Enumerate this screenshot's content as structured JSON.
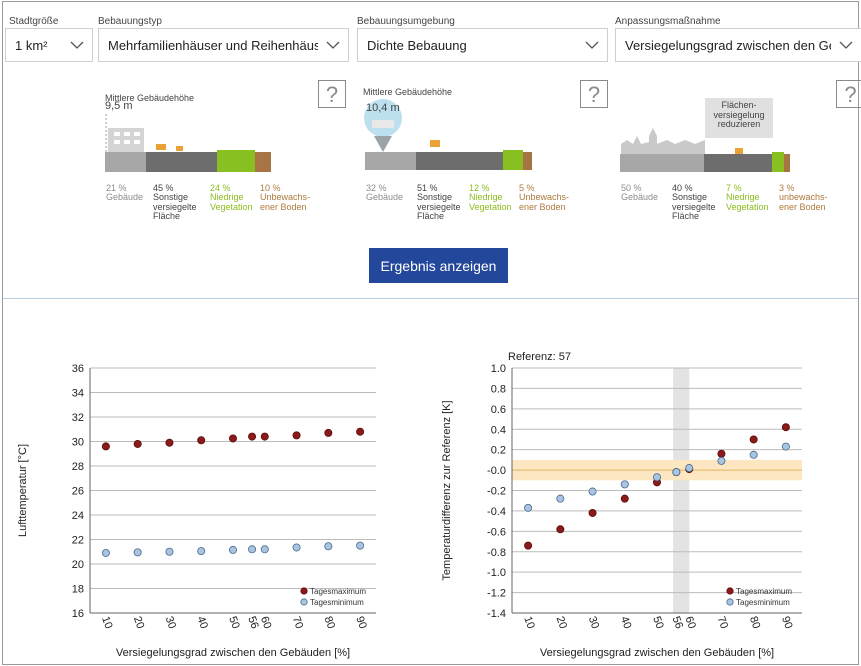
{
  "selectors": [
    {
      "label": "Stadtgröße",
      "value": "1 km²"
    },
    {
      "label": "Bebauungstyp",
      "value": "Mehrfamilienhäuser und Reihenhäuser"
    },
    {
      "label": "Bebauungsumgebung",
      "value": "Dichte Bebauung"
    },
    {
      "label": "Anpassungsmaßnahme",
      "value": "Versiegelungsgrad zwischen den Gebäuden"
    }
  ],
  "help_glyph": "?",
  "panels": [
    {
      "height_label": "Mittlere Gebäudehöhe",
      "height_value": "9,5 m",
      "shares": [
        {
          "pct": "21 %",
          "text": "Gebäude"
        },
        {
          "pct": "45 %",
          "text": "Sonstige versiegelte Fläche"
        },
        {
          "pct": "24 %",
          "text": "Niedrige Vegetation"
        },
        {
          "pct": "10 %",
          "text": "Unbewachs-ener Boden"
        }
      ]
    },
    {
      "height_label": "Mittlere Gebäudehöhe",
      "height_value": "10,4 m",
      "shares": [
        {
          "pct": "32 %",
          "text": "Gebäude"
        },
        {
          "pct": "51 %",
          "text": "Sonstige versiegelte Fläche"
        },
        {
          "pct": "12 %",
          "text": "Niedrige Vegetation"
        },
        {
          "pct": "5 %",
          "text": "Unbewachs-ener Boden"
        }
      ]
    },
    {
      "callout": "Flächen-versiegelung reduzieren",
      "shares": [
        {
          "pct": "50 %",
          "text": "Gebäude"
        },
        {
          "pct": "40 %",
          "text": "Sonstige versiegelte Fläche"
        },
        {
          "pct": "7 %",
          "text": "Niedrige Vegetation"
        },
        {
          "pct": "3 %",
          "text": "unbewachs-ener Boden"
        }
      ]
    }
  ],
  "result_button": "Ergebnis anzeigen",
  "colors": {
    "accent": "#23479a",
    "max": "#8b1a1a",
    "min": "#a8c4e0",
    "band": "#fde7c2",
    "refband": "#e3e3e3"
  },
  "chart_data": [
    {
      "type": "scatter",
      "xlabel": "Versiegelungsgrad zwischen den Gebäuden [%]",
      "ylabel": "Lufttemperatur [°C]",
      "ylim": [
        16,
        36
      ],
      "yticks": [
        16,
        18,
        20,
        22,
        24,
        26,
        28,
        30,
        32,
        34,
        36
      ],
      "x_tick_labels": [
        "10",
        "20",
        "30",
        "40",
        "50",
        "56",
        "60",
        "70",
        "80",
        "90"
      ],
      "legend_placement": "bottom-right",
      "grid": true,
      "series": [
        {
          "name": "Tagesmaximum",
          "x": [
            10,
            20,
            30,
            40,
            50,
            56,
            60,
            70,
            80,
            90
          ],
          "y": [
            29.6,
            29.8,
            29.9,
            30.1,
            30.25,
            30.4,
            30.4,
            30.5,
            30.7,
            30.8
          ]
        },
        {
          "name": "Tagesminimum",
          "x": [
            10,
            20,
            30,
            40,
            50,
            56,
            60,
            70,
            80,
            90
          ],
          "y": [
            20.9,
            20.95,
            21.0,
            21.05,
            21.15,
            21.2,
            21.2,
            21.35,
            21.45,
            21.5
          ]
        }
      ]
    },
    {
      "type": "scatter",
      "title": "Referenz: 57",
      "xlabel": "Versiegelungsgrad zwischen den Gebäuden [%]",
      "ylabel": "Temperaturdifferenz zur Referenz [K]",
      "ylim": [
        -1.4,
        1.0
      ],
      "yticks": [
        "1.0",
        "0.8",
        "0.6",
        "0.4",
        "0.2",
        "-0.0",
        "-0.2",
        "-0.4",
        "-0.6",
        "-0.8",
        "-1.0",
        "-1.2",
        "-1.4"
      ],
      "x_tick_labels": [
        "10",
        "20",
        "30",
        "40",
        "50",
        "56",
        "60",
        "70",
        "80",
        "90"
      ],
      "legend_placement": "bottom-right",
      "grid": true,
      "reference_band_x": [
        55,
        60
      ],
      "tolerance_band_y": [
        -0.1,
        0.1
      ],
      "series": [
        {
          "name": "Tagesmaximum",
          "x": [
            10,
            20,
            30,
            40,
            50,
            56,
            60,
            70,
            80,
            90
          ],
          "y": [
            -0.74,
            -0.58,
            -0.42,
            -0.28,
            -0.12,
            -0.02,
            0.01,
            0.16,
            0.3,
            0.42
          ]
        },
        {
          "name": "Tagesminimum",
          "x": [
            10,
            20,
            30,
            40,
            50,
            56,
            60,
            70,
            80,
            90
          ],
          "y": [
            -0.37,
            -0.28,
            -0.21,
            -0.14,
            -0.07,
            -0.02,
            0.02,
            0.09,
            0.15,
            0.23
          ]
        }
      ]
    }
  ]
}
